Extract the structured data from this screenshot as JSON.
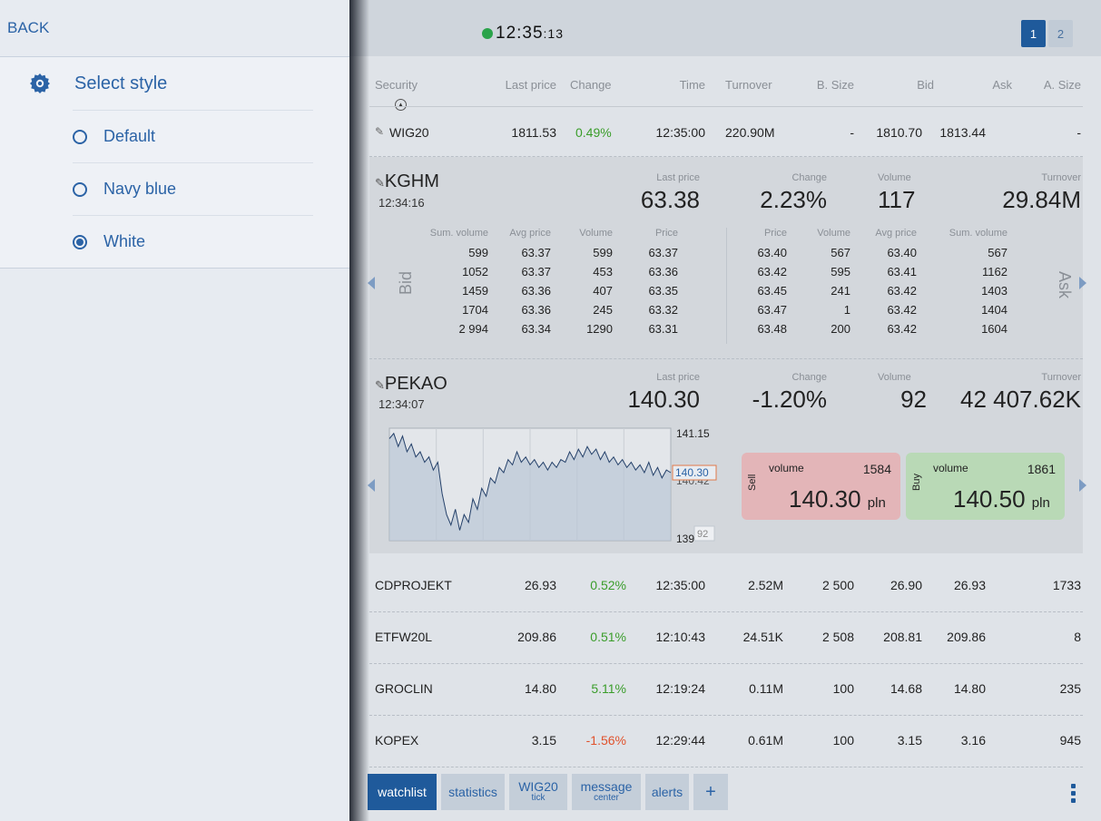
{
  "sidebar": {
    "back_label": "BACK",
    "section_title": "Select style",
    "options": [
      {
        "label": "Default",
        "selected": false
      },
      {
        "label": "Navy blue",
        "selected": false
      },
      {
        "label": "White",
        "selected": true
      }
    ]
  },
  "topbar": {
    "clock_hm": "12:35",
    "clock_sec": ":13",
    "status_color": "#2aa34a",
    "pages": [
      "1",
      "2"
    ],
    "active_page": "1"
  },
  "table": {
    "headers": [
      "Security",
      "Last price",
      "Change",
      "Time",
      "Turnover",
      "B. Size",
      "Bid",
      "Ask",
      "A. Size"
    ],
    "index_row": {
      "name": "WIG20",
      "last": "1811.53",
      "change": "0.49%",
      "time": "12:35:00",
      "turnover": "220.90M",
      "bsize": "-",
      "bid": "1810.70",
      "ask": "1813.44",
      "asize": "-"
    },
    "rows": [
      {
        "name": "CDPROJEKT",
        "last": "26.93",
        "change": "0.52%",
        "dir": "up",
        "time": "12:35:00",
        "turnover": "2.52M",
        "bsize": "2 500",
        "bid": "26.90",
        "ask": "26.93",
        "asize": "1733"
      },
      {
        "name": "ETFW20L",
        "last": "209.86",
        "change": "0.51%",
        "dir": "up",
        "time": "12:10:43",
        "turnover": "24.51K",
        "bsize": "2 508",
        "bid": "208.81",
        "ask": "209.86",
        "asize": "8"
      },
      {
        "name": "GROCLIN",
        "last": "14.80",
        "change": "5.11%",
        "dir": "up",
        "time": "12:19:24",
        "turnover": "0.11M",
        "bsize": "100",
        "bid": "14.68",
        "ask": "14.80",
        "asize": "235"
      },
      {
        "name": "KOPEX",
        "last": "3.15",
        "change": "-1.56%",
        "dir": "down",
        "time": "12:29:44",
        "turnover": "0.61M",
        "bsize": "100",
        "bid": "3.15",
        "ask": "3.16",
        "asize": "945"
      }
    ]
  },
  "kghm": {
    "name": "KGHM",
    "time": "12:34:16",
    "labels": {
      "last": "Last price",
      "change": "Change",
      "volume": "Volume",
      "turnover": "Turnover"
    },
    "last": "63.38",
    "change": "2.23%",
    "volume": "117",
    "turnover": "29.84M",
    "bid_label": "Bid",
    "ask_label": "Ask",
    "bid_headers": [
      "Sum. volume",
      "Avg price",
      "Volume",
      "Price"
    ],
    "ask_headers": [
      "Price",
      "Volume",
      "Avg price",
      "Sum. volume"
    ],
    "bids": [
      [
        "599",
        "63.37",
        "599",
        "63.37"
      ],
      [
        "1052",
        "63.37",
        "453",
        "63.36"
      ],
      [
        "1459",
        "63.36",
        "407",
        "63.35"
      ],
      [
        "1704",
        "63.36",
        "245",
        "63.32"
      ],
      [
        "2 994",
        "63.34",
        "1290",
        "63.31"
      ]
    ],
    "asks": [
      [
        "63.40",
        "567",
        "63.40",
        "567"
      ],
      [
        "63.42",
        "595",
        "63.41",
        "1162"
      ],
      [
        "63.45",
        "241",
        "63.42",
        "1403"
      ],
      [
        "63.47",
        "1",
        "63.42",
        "1404"
      ],
      [
        "63.48",
        "200",
        "63.42",
        "1604"
      ]
    ]
  },
  "pekao": {
    "name": "PEKAO",
    "time": "12:34:07",
    "labels": {
      "last": "Last price",
      "change": "Change",
      "volume": "Volume",
      "turnover": "Turnover"
    },
    "last": "140.30",
    "change": "-1.20%",
    "volume": "92",
    "turnover": "42 407.62K",
    "chart": {
      "type": "line",
      "y_top_label": "141.15",
      "y_mid_label": "140.42",
      "y_bottom_label": "139",
      "current_price_label": "140.30",
      "volume_tag": "92",
      "ylim": [
        139,
        141.15
      ],
      "values": [
        140.95,
        141.05,
        140.8,
        141.0,
        140.7,
        140.85,
        140.6,
        140.7,
        140.5,
        140.6,
        140.35,
        140.5,
        139.9,
        139.5,
        139.3,
        139.6,
        139.2,
        139.5,
        139.35,
        139.8,
        139.6,
        140.0,
        139.85,
        140.2,
        140.1,
        140.4,
        140.3,
        140.55,
        140.45,
        140.7,
        140.5,
        140.6,
        140.45,
        140.55,
        140.4,
        140.5,
        140.35,
        140.5,
        140.4,
        140.55,
        140.5,
        140.7,
        140.55,
        140.75,
        140.6,
        140.8,
        140.65,
        140.75,
        140.55,
        140.7,
        140.5,
        140.6,
        140.45,
        140.55,
        140.4,
        140.5,
        140.35,
        140.45,
        140.3,
        140.5,
        140.25,
        140.4,
        140.2,
        140.35,
        140.3
      ]
    },
    "sell": {
      "side": "Sell",
      "volume_label": "volume",
      "volume": "1584",
      "price": "140.30",
      "unit": "pln"
    },
    "buy": {
      "side": "Buy",
      "volume_label": "volume",
      "volume": "1861",
      "price": "140.50",
      "unit": "pln"
    }
  },
  "tabs": [
    {
      "label": "watchlist",
      "sub": "",
      "active": true
    },
    {
      "label": "statistics",
      "sub": "",
      "active": false
    },
    {
      "label": "WIG20",
      "sub": "tick",
      "active": false
    },
    {
      "label": "message",
      "sub": "center",
      "active": false
    },
    {
      "label": "alerts",
      "sub": "",
      "active": false
    },
    {
      "label": "+",
      "sub": "",
      "active": false
    }
  ],
  "colors": {
    "accent": "#1f5a9b",
    "up": "#3a9d2a",
    "down": "#e0522c",
    "sell": "#e3b5b8",
    "buy": "#b9d9b6"
  }
}
